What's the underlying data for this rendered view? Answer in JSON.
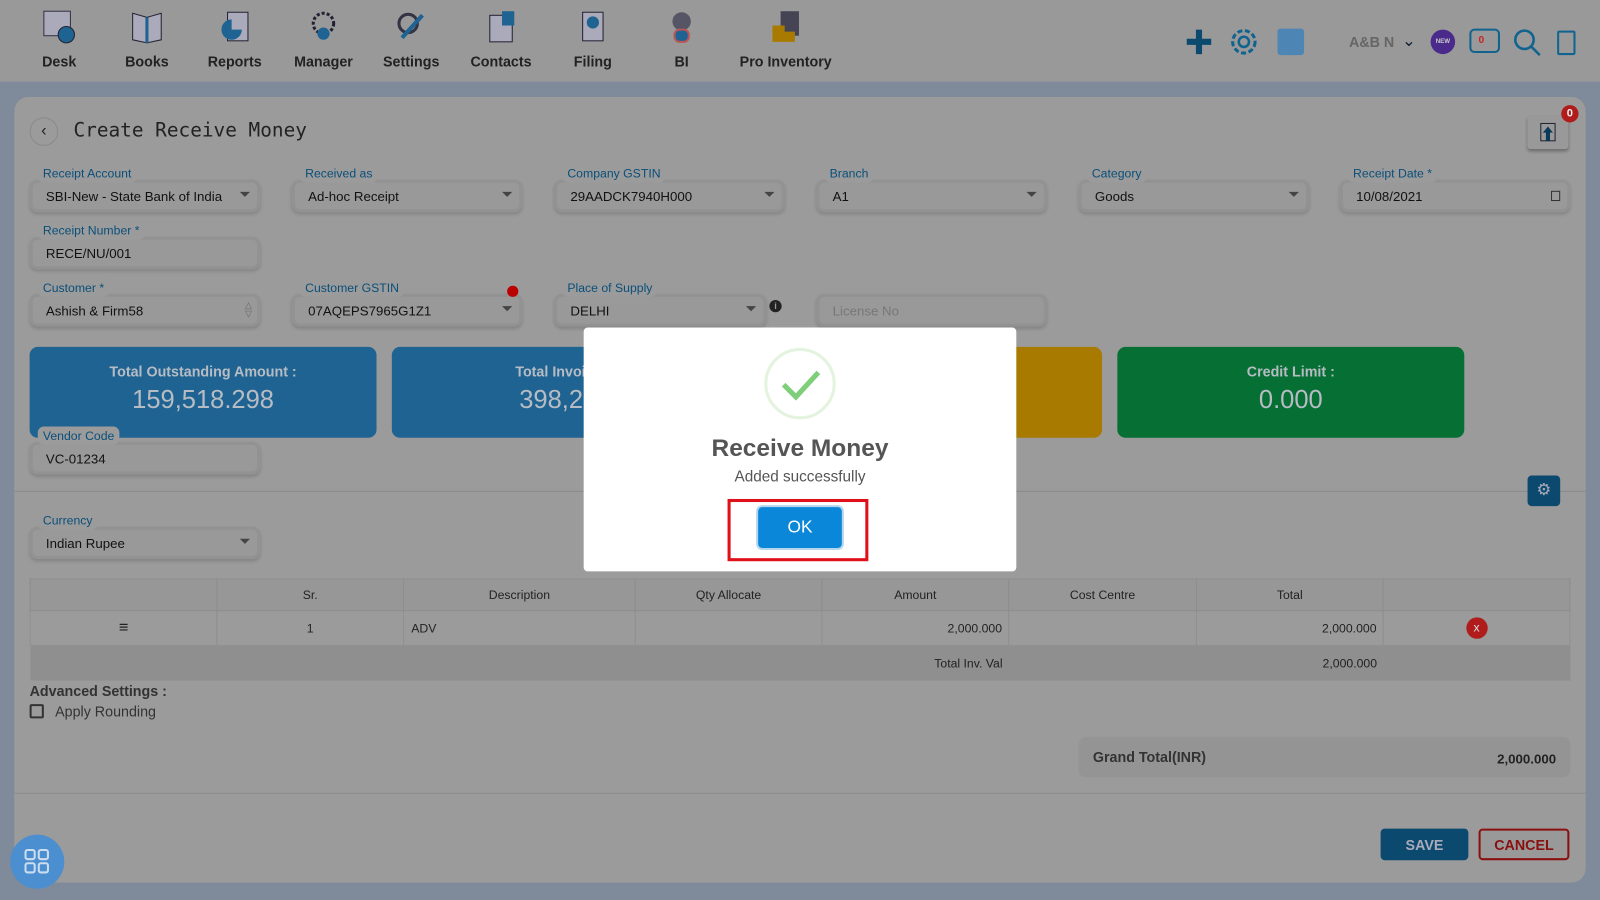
{
  "nav": {
    "items": [
      {
        "label": "Desk",
        "icon": "desk-icon"
      },
      {
        "label": "Books",
        "icon": "books-icon"
      },
      {
        "label": "Reports",
        "icon": "reports-icon"
      },
      {
        "label": "Manager",
        "icon": "manager-icon"
      },
      {
        "label": "Settings",
        "icon": "settings-icon"
      },
      {
        "label": "Contacts",
        "icon": "contacts-icon"
      },
      {
        "label": "Filing",
        "icon": "filing-icon"
      },
      {
        "label": "BI",
        "icon": "bi-icon"
      },
      {
        "label": "Pro Inventory",
        "icon": "pro-inventory-icon"
      }
    ],
    "company": "A&B N",
    "notification_count": "0",
    "new_badge": "NEW"
  },
  "page": {
    "title": "Create Receive Money",
    "upload_count": "0"
  },
  "form": {
    "receipt_account": {
      "label": "Receipt Account",
      "value": "SBI-New - State Bank of India"
    },
    "received_as": {
      "label": "Received as",
      "value": "Ad-hoc Receipt"
    },
    "company_gstin": {
      "label": "Company GSTIN",
      "value": "29AADCK7940H000"
    },
    "branch": {
      "label": "Branch",
      "value": "A1"
    },
    "category": {
      "label": "Category",
      "value": "Goods"
    },
    "receipt_date": {
      "label": "Receipt Date *",
      "value": "10/08/2021"
    },
    "receipt_number": {
      "label": "Receipt Number *",
      "value": "RECE/NU/001"
    },
    "customer": {
      "label": "Customer *",
      "value": "Ashish & Firm58"
    },
    "customer_gstin": {
      "label": "Customer GSTIN",
      "value": "07AQEPS7965G1Z1"
    },
    "place_of_supply": {
      "label": "Place of Supply",
      "value": "DELHI"
    },
    "license_no": {
      "placeholder": "License No"
    },
    "vendor_code": {
      "label": "Vendor Code",
      "value": "VC-01234"
    },
    "currency": {
      "label": "Currency",
      "value": "Indian Rupee"
    }
  },
  "stats": [
    {
      "title": "Total Outstanding Amount :",
      "value": "159,518.298",
      "color": "#1e6391"
    },
    {
      "title": "Total Invoice A",
      "value": "398,267",
      "color": "#1e6391"
    },
    {
      "color": "#a87a00"
    },
    {
      "title": "Credit Limit :",
      "value": "0.000",
      "color": "#067034"
    }
  ],
  "table": {
    "headers": [
      "",
      "Sr.",
      "Description",
      "Qty Allocate",
      "Amount",
      "Cost Centre",
      "Total",
      ""
    ],
    "rows": [
      {
        "sr": "1",
        "description": "ADV",
        "qty": "",
        "amount": "2,000.000",
        "cost_centre": "",
        "total": "2,000.000"
      }
    ],
    "footer_label": "Total Inv. Val",
    "footer_total": "2,000.000"
  },
  "advanced": {
    "title": "Advanced Settings :",
    "apply_rounding": "Apply Rounding",
    "apply_rounding_checked": false
  },
  "grand_total": {
    "label": "Grand Total(INR)",
    "value": "2,000.000"
  },
  "actions": {
    "save": "SAVE",
    "cancel": "CANCEL"
  },
  "dialog": {
    "title": "Receive Money",
    "message": "Added successfully",
    "ok": "OK"
  }
}
